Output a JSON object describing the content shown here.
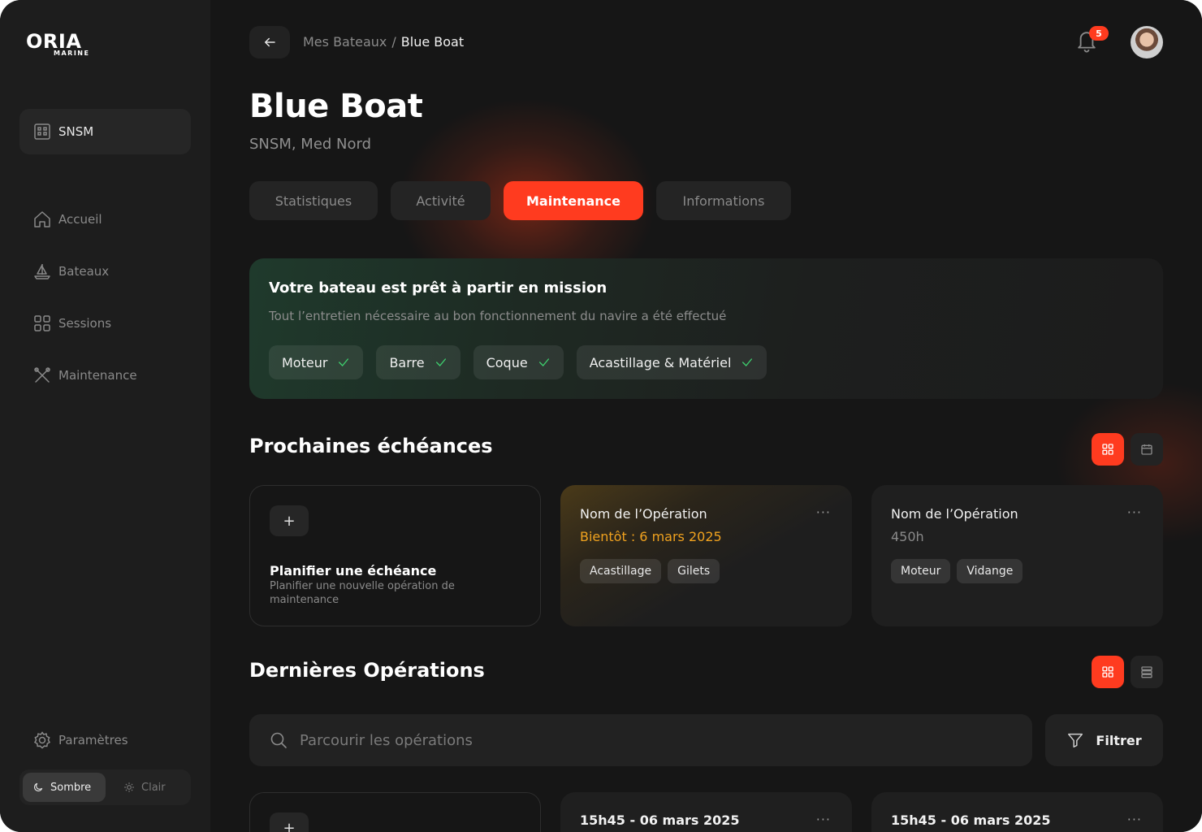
{
  "brand": {
    "name": "ORIA",
    "sub": "MARINE"
  },
  "sidebar": {
    "org": "SNSM",
    "items": [
      {
        "label": "Accueil",
        "icon": "home-icon"
      },
      {
        "label": "Bateaux",
        "icon": "boat-icon"
      },
      {
        "label": "Sessions",
        "icon": "grid-icon"
      },
      {
        "label": "Maintenance",
        "icon": "tools-icon"
      }
    ],
    "settings": "Paramètres",
    "theme": {
      "dark": "Sombre",
      "light": "Clair"
    }
  },
  "header": {
    "breadcrumb": {
      "parent": "Mes Bateaux",
      "separator": "/",
      "current": "Blue Boat"
    },
    "notifications": "5"
  },
  "page": {
    "title": "Blue Boat",
    "subtitle": "SNSM, Med Nord"
  },
  "tabs": [
    "Statistiques",
    "Activité",
    "Maintenance",
    "Informations"
  ],
  "status": {
    "title": "Votre bateau est prêt à partir en mission",
    "description": "Tout l’entretien nécessaire au bon fonctionnement du navire a été effectué",
    "chips": [
      "Moteur",
      "Barre",
      "Coque",
      "Acastillage & Matériel"
    ]
  },
  "upcoming": {
    "title": "Prochaines échéances",
    "add_card": {
      "plus": "+",
      "title": "Planifier une échéance",
      "description": "Planifier une nouvelle opération de maintenance"
    },
    "cards": [
      {
        "name": "Nom de l’Opération",
        "sub": "Bientôt : 6 mars 2025",
        "tags": [
          "Acastillage",
          "Gilets"
        ]
      },
      {
        "name": "Nom de l’Opération",
        "sub": "450h",
        "tags": [
          "Moteur",
          "Vidange"
        ]
      }
    ],
    "more": "···"
  },
  "latest": {
    "title": "Dernières Opérations",
    "search_placeholder": "Parcourir les opérations",
    "filter": "Filtrer",
    "plus": "+",
    "cards": [
      {
        "name": "15h45 - 06 mars 2025"
      },
      {
        "name": "15h45 - 06 mars 2025"
      }
    ],
    "more": "···"
  },
  "colors": {
    "accent": "#ff3b1f",
    "success": "#3ecf6e",
    "warning": "#f0a21f"
  }
}
